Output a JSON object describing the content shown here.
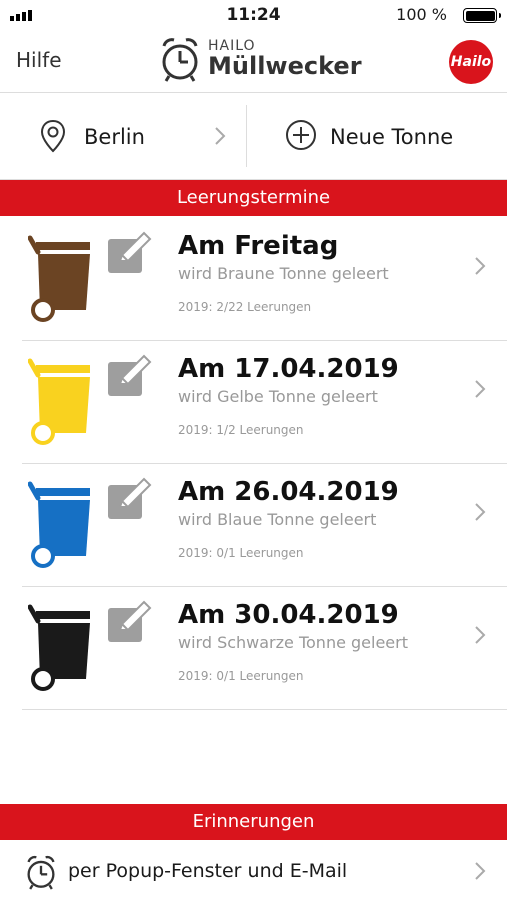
{
  "status_bar": {
    "time": "11:24",
    "battery": "100 %"
  },
  "header": {
    "help_label": "Hilfe",
    "logo_small": "HAILO",
    "logo_big": "Müllwecker",
    "brand_badge": "Hailo"
  },
  "location": {
    "city": "Berlin",
    "new_bin_label": "Neue Tonne"
  },
  "sections": {
    "dates_title": "Leerungstermine",
    "reminders_title": "Erinnerungen"
  },
  "bins": [
    {
      "date": "Am Freitag",
      "description": "wird Braune Tonne geleert",
      "count": "2019: 2/22 Leerungen",
      "color": "#6b4423"
    },
    {
      "date": "Am 17.04.2019",
      "description": "wird Gelbe Tonne geleert",
      "count": "2019: 1/2 Leerungen",
      "color": "#f9d21f"
    },
    {
      "date": "Am 26.04.2019",
      "description": "wird Blaue Tonne geleert",
      "count": "2019: 0/1 Leerungen",
      "color": "#1670c4"
    },
    {
      "date": "Am 30.04.2019",
      "description": "wird Schwarze Tonne geleert",
      "count": "2019: 0/1 Leerungen",
      "color": "#1a1a1a"
    }
  ],
  "reminder": {
    "label": "per Popup-Fenster und E-Mail"
  },
  "colors": {
    "accent": "#d9141c"
  }
}
